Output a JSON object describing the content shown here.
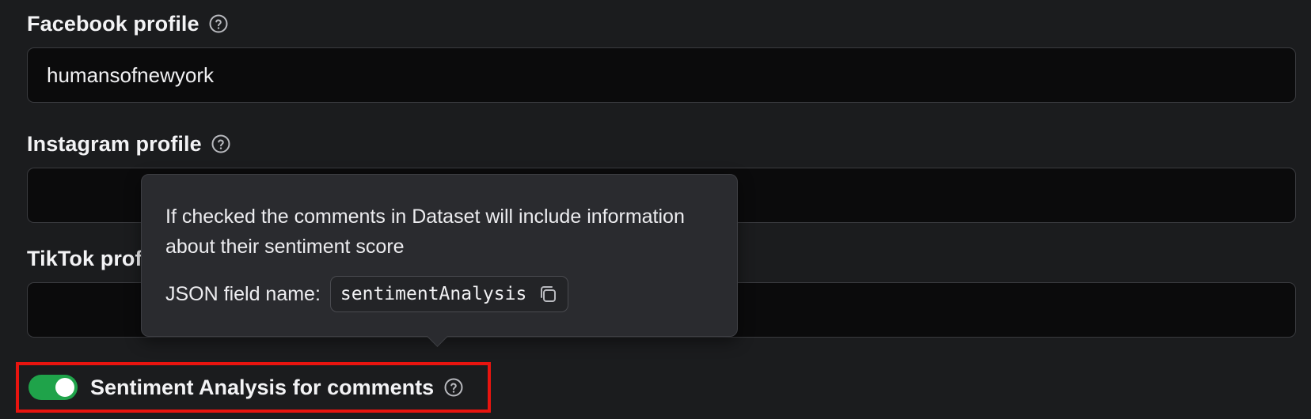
{
  "form": {
    "facebook": {
      "label": "Facebook profile",
      "value": "humansofnewyork",
      "help_icon": "question-circle-icon"
    },
    "instagram": {
      "label": "Instagram profile",
      "value": "",
      "help_icon": "question-circle-icon"
    },
    "tiktok": {
      "label": "TikTok profile",
      "value": "",
      "help_icon": "question-circle-icon"
    },
    "sentiment": {
      "label": "Sentiment Analysis for comments",
      "checked": true,
      "help_icon": "question-circle-icon"
    }
  },
  "tooltip": {
    "text": "If checked the comments in Dataset will include information about their sentiment score",
    "json_label": "JSON field name:",
    "json_field": "sentimentAnalysis",
    "copy_icon": "copy-icon"
  },
  "colors": {
    "background": "#1b1c1e",
    "input_background": "#0b0b0c",
    "toggle_on": "#1fa34a",
    "highlight_border": "#e8140f",
    "tooltip_background": "#2a2b2f"
  }
}
